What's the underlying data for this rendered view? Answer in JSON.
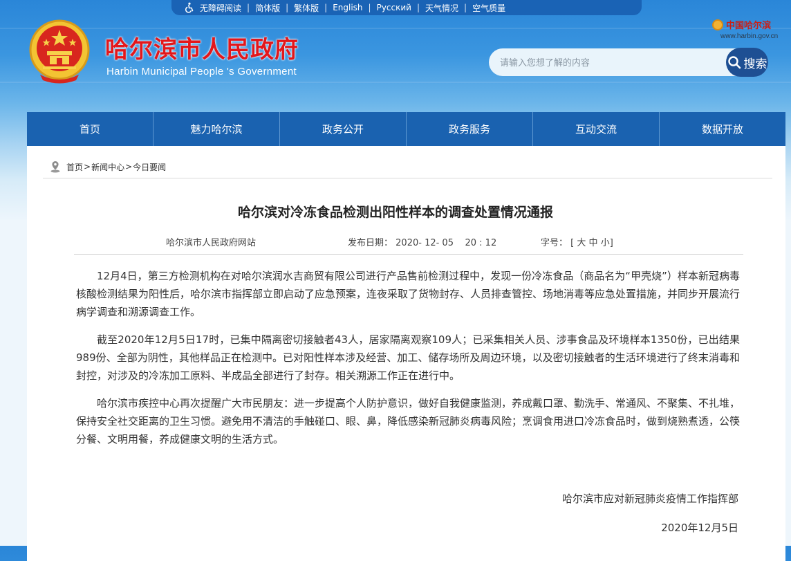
{
  "topbar": {
    "items": [
      "无障碍阅读",
      "简体版",
      "繁体版",
      "English",
      "Русский",
      "天气情况",
      "空气质量"
    ]
  },
  "header": {
    "title": "哈尔滨市人民政府",
    "subtitle": "Harbin Municipal People 's Government",
    "right_logo_text": "中国哈尔滨",
    "right_logo_domain": "www.harbin.gov.cn",
    "search": {
      "placeholder": "请输入您想了解的内容",
      "button_label": "搜索"
    }
  },
  "nav": {
    "items": [
      "首页",
      "魅力哈尔滨",
      "政务公开",
      "政务服务",
      "互动交流",
      "数据开放"
    ]
  },
  "breadcrumb": {
    "items": [
      "首页",
      "新闻中心",
      "今日要闻"
    ],
    "separator": ">"
  },
  "article": {
    "title": "哈尔滨对冷冻食品检测出阳性样本的调查处置情况通报",
    "source": "哈尔滨市人民政府网站",
    "date_label": "发布日期：",
    "date_value": "2020- 12- 05    20 : 12",
    "size_label": "字号：",
    "size_open": "[",
    "size_large": "大",
    "size_medium": "中",
    "size_small": "小",
    "size_close": "]",
    "paragraphs": [
      "12月4日，第三方检测机构在对哈尔滨润水吉商贸有限公司进行产品售前检测过程中，发现一份冷冻食品（商品名为“甲壳烧”）样本新冠病毒核酸检测结果为阳性后，哈尔滨市指挥部立即启动了应急预案，连夜采取了货物封存、人员排查管控、场地消毒等应急处置措施，并同步开展流行病学调查和溯源调查工作。",
      "截至2020年12月5日17时，已集中隔离密切接触者43人，居家隔离观察109人；已采集相关人员、涉事食品及环境样本1350份，已出结果989份、全部为阴性，其他样品正在检测中。已对阳性样本涉及经营、加工、储存场所及周边环境，以及密切接触者的生活环境进行了终末消毒和封控，对涉及的冷冻加工原料、半成品全部进行了封存。相关溯源工作正在进行中。",
      "哈尔滨市疾控中心再次提醒广大市民朋友：进一步提高个人防护意识，做好自我健康监测，养成戴口罩、勤洗手、常通风、不聚集、不扎堆，保持安全社交距离的卫生习惯。避免用不清洁的手触碰口、眼、鼻，降低感染新冠肺炎病毒风险；烹调食用进口冷冻食品时，做到烧熟煮透，公筷分餐、文明用餐，养成健康文明的生活方式。"
    ],
    "signature": "哈尔滨市应对新冠肺炎疫情工作指挥部",
    "signature_date": "2020年12月5日"
  },
  "colors": {
    "header_blue": "#2a86d8",
    "nav_blue": "#1a62b0",
    "title_red": "#e3171b",
    "search_button": "#1e4f93"
  },
  "icons": [
    "wheelchair-icon",
    "national-emblem",
    "harbin-logo-mark",
    "search-icon",
    "location-pin-icon"
  ]
}
